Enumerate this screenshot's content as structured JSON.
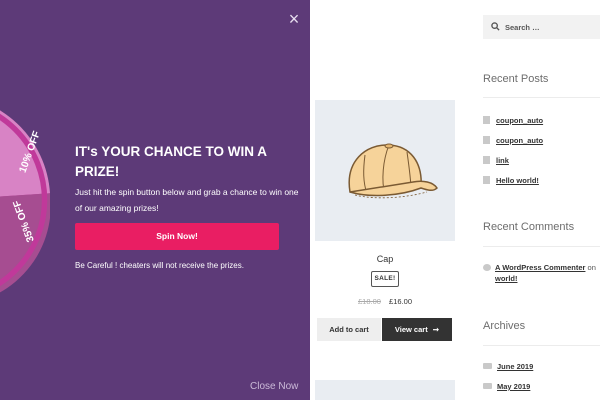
{
  "popup": {
    "headline": "IT's YOUR CHANCE TO WIN A PRIZE!",
    "subtext": "Just hit the spin button below and grab a chance to win one of our amazing prizes!",
    "spin_button": "Spin Now!",
    "warning": "Be Careful ! cheaters will not receive the prizes.",
    "close_now": "Close Now",
    "close_icon": "×",
    "wheel": {
      "segments": [
        {
          "label": "10% OFF",
          "color": "#d883c5"
        },
        {
          "label": "35% OFF",
          "color": "#a64d91"
        }
      ],
      "rim_color": "#c0399a"
    }
  },
  "product": {
    "title": "Cap",
    "sale_badge": "SALE!",
    "price_old": "£18.00",
    "price_new": "£16.00",
    "add_to_cart": "Add to cart",
    "view_cart": "View cart"
  },
  "sidebar": {
    "search_placeholder": "Search …",
    "recent_posts_title": "Recent Posts",
    "recent_posts": [
      "coupon_auto",
      "coupon_auto",
      "link",
      "Hello world!"
    ],
    "recent_comments_title": "Recent Comments",
    "comment": {
      "author": "A WordPress Commenter",
      "on": "on",
      "post": "world!"
    },
    "archives_title": "Archives",
    "archives": [
      "June 2019",
      "May 2019"
    ]
  },
  "colors": {
    "popup_bg": "#5d3a78",
    "spin_button": "#e91e63",
    "view_cart_bg": "#333333"
  }
}
